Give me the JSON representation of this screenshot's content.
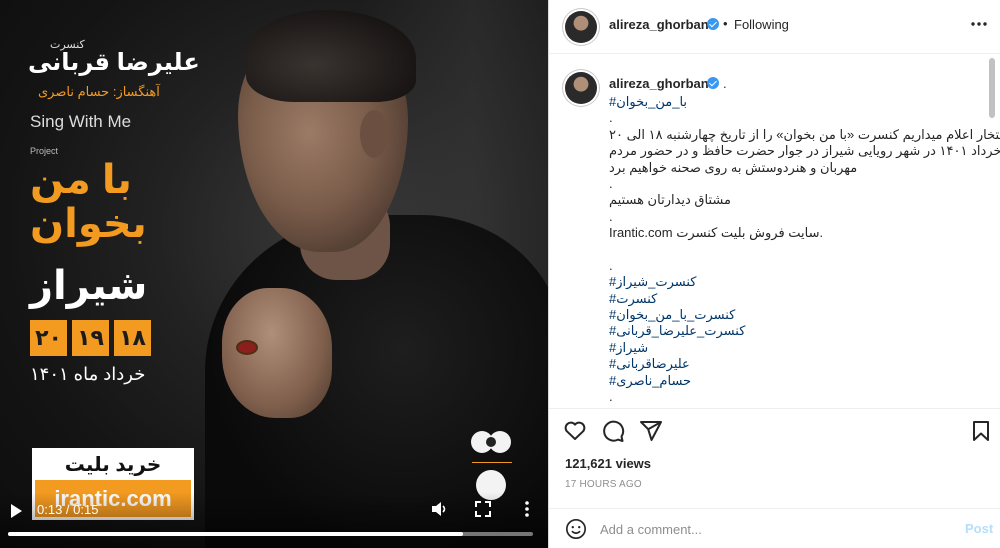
{
  "poster": {
    "concert_label": "کنسرت",
    "artist_name": "علیرضا قربانی",
    "composer_line": "آهنگساز: حسام ناصری",
    "sing_with_me": "Sing With Me",
    "project": "Project",
    "title_line1": "با من",
    "title_line2": "بخوان",
    "city": "شیراز",
    "days": [
      "۱۸",
      "۱۹",
      "۲۰"
    ],
    "month_year": "خرداد ماه ۱۴۰۱",
    "buy_ticket": "خرید بلیت",
    "ticket_site": "irantic.com"
  },
  "video": {
    "time_display": "0:13 / 0:15",
    "progress_fraction": 0.867
  },
  "header": {
    "username": "alireza_ghorbani",
    "separator": "•",
    "following_label": "Following"
  },
  "caption": {
    "username": "alireza_ghorbani",
    "dot": ".",
    "hashtag_main": "#با_من_بخوان",
    "lines": [
      ".",
      "با افتخار اعلام میداریم کنسرت «با من بخوان» را از تاریخ چهارشنبه ۱۸ الی ۲۰",
      "خرداد ۱۴۰۱ در شهر رویایی شیراز در جوار حضرت حافظ و در حضور مردم",
      "مهربان و هنردوستش به روی صحنه خواهیم برد",
      ".",
      "مشتاق دیدارتان هستیم",
      ".",
      "Irantic.com سایت فروش بلیت کنسرت.",
      "",
      "."
    ],
    "hashtags": [
      "#کنسرت_شیراز",
      "#کنسرت",
      "#کنسرت_با_من_بخوان",
      "#کنسرت_علیرضا_قربانی",
      "#شیراز",
      "#علیرضاقربانی",
      "#حسام_ناصری"
    ],
    "end_dot": "."
  },
  "stats": {
    "views": "121,621 views",
    "time_ago": "17 HOURS AGO"
  },
  "comment": {
    "placeholder": "Add a comment...",
    "post_label": "Post"
  },
  "colors": {
    "accent_orange": "#f39a21",
    "link_blue": "#00376b",
    "verified_blue": "#3897f0",
    "post_disabled": "#b2dffc"
  },
  "icons": [
    "play-icon",
    "volume-icon",
    "fullscreen-icon",
    "more-vertical-icon",
    "more-horizontal-icon",
    "heart-icon",
    "comment-icon",
    "share-icon",
    "bookmark-icon",
    "emoji-icon",
    "verified-icon"
  ]
}
